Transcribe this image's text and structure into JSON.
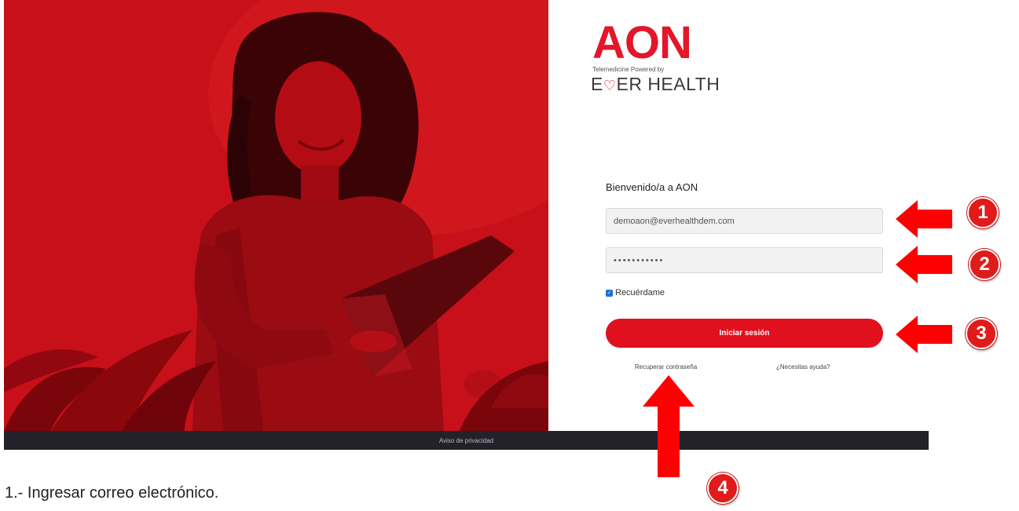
{
  "brand": {
    "logo": "AON",
    "powered_by": "Telemedicine Powered by",
    "partner_prefix": "E",
    "partner_suffix": "ER HEALTH",
    "partner_heart": "♡"
  },
  "form": {
    "welcome": "Bienvenido/a a AON",
    "email_value": "demoaon@everhealthdem.com",
    "password_value": "•••••••••••",
    "remember_label": "Recuérdame",
    "remember_checked": true,
    "login_button": "Iniciar sesión",
    "recover_link": "Recuperar contraseña",
    "help_link": "¿Necesitas ayuda?"
  },
  "footer": {
    "privacy_link": "Aviso de privacidad"
  },
  "annotations": {
    "badges": [
      "1",
      "2",
      "3",
      "4"
    ],
    "color": "#e11a1a",
    "caption": "1.- Ingresar correo electrónico."
  },
  "colors": {
    "brand_red": "#e3162a",
    "button_red": "#e0101f",
    "footer_bg": "#23222b",
    "checkbox_blue": "#1d6fd8"
  }
}
